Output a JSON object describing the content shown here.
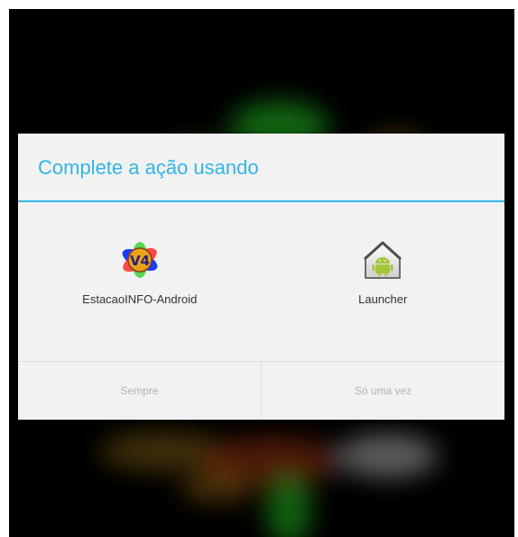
{
  "dialog": {
    "title": "Complete a ação usando",
    "apps": [
      {
        "label": "EstacaoINFO-Android",
        "icon": "estacaoinfo-v4-app-icon",
        "badge": "V4"
      },
      {
        "label": "Launcher",
        "icon": "android-launcher-house-icon"
      }
    ],
    "buttons": {
      "always": "Sempre",
      "once": "Só uma vez"
    }
  },
  "colors": {
    "accent": "#33b5e5",
    "dialog_bg": "#f2f2f2",
    "button_text_disabled": "#b3b3b3",
    "android_green": "#a4c639"
  }
}
